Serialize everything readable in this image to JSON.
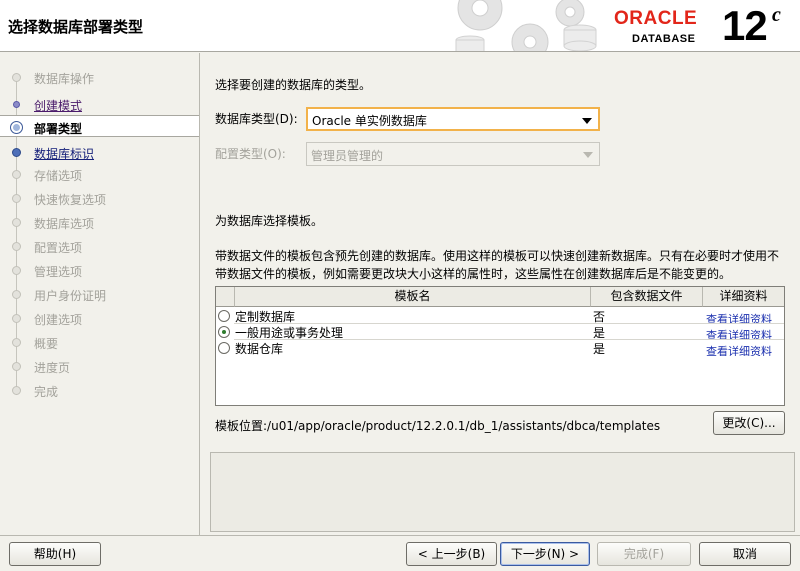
{
  "header": {
    "title": "选择数据库部署类型",
    "brand": "ORACLE",
    "product": "DATABASE",
    "version": "12",
    "version_suffix": "c"
  },
  "sidebar": {
    "steps": [
      {
        "label": "数据库操作",
        "state": "pending"
      },
      {
        "label": "创建模式",
        "state": "done"
      },
      {
        "label": "部署类型",
        "state": "current"
      },
      {
        "label": "数据库标识",
        "state": "link"
      },
      {
        "label": "存储选项",
        "state": "pending"
      },
      {
        "label": "快速恢复选项",
        "state": "pending"
      },
      {
        "label": "数据库选项",
        "state": "pending"
      },
      {
        "label": "配置选项",
        "state": "pending"
      },
      {
        "label": "管理选项",
        "state": "pending"
      },
      {
        "label": "用户身份证明",
        "state": "pending"
      },
      {
        "label": "创建选项",
        "state": "pending"
      },
      {
        "label": "概要",
        "state": "pending"
      },
      {
        "label": "进度页",
        "state": "pending"
      },
      {
        "label": "完成",
        "state": "pending"
      }
    ]
  },
  "main": {
    "intro": "选择要创建的数据库的类型。",
    "db_type_label": "数据库类型(D):",
    "db_type_value": "Oracle 单实例数据库",
    "config_type_label": "配置类型(O):",
    "config_type_value": "管理员管理的",
    "template_heading": "为数据库选择模板。",
    "template_desc_1": "带数据文件的模板包含预先创建的数据库。使用这样的模板可以快速创建新数据库。只有在必要时才使用不",
    "template_desc_2": "带数据文件的模板，例如需要更改块大小这样的属性时，这些属性在创建数据库后是不能变更的。",
    "table": {
      "headers": [
        "模板名",
        "包含数据文件",
        "详细资料"
      ],
      "rows": [
        {
          "name": "定制数据库",
          "includes": "否",
          "details": "查看详细资料",
          "selected": false
        },
        {
          "name": "一般用途或事务处理",
          "includes": "是",
          "details": "查看详细资料",
          "selected": true
        },
        {
          "name": "数据仓库",
          "includes": "是",
          "details": "查看详细资料",
          "selected": false
        }
      ]
    },
    "template_location": "模板位置:/u01/app/oracle/product/12.2.0.1/db_1/assistants/dbca/templates",
    "change_button": "更改(C)..."
  },
  "footer": {
    "help": "帮助(H)",
    "back": "< 上一步(B)",
    "next": "下一步(N) >",
    "finish": "完成(F)",
    "cancel": "取消"
  },
  "colors": {
    "brand_red": "#e2261a",
    "focus_orange": "#f2b24a",
    "link_blue": "#1a2fae"
  }
}
